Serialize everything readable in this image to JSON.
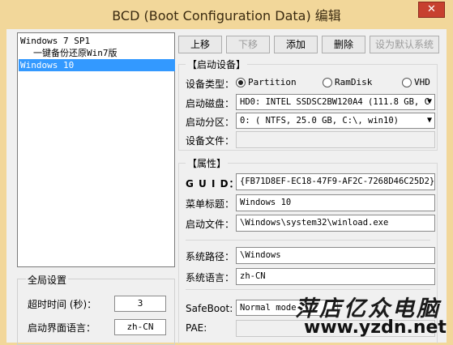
{
  "window": {
    "title": "BCD (Boot Configuration Data) 编辑",
    "close_glyph": "✕"
  },
  "boot_list": {
    "items": [
      {
        "label": "Windows 7 SP1",
        "indent": false,
        "selected": false
      },
      {
        "label": "一键备份还原Win7版",
        "indent": true,
        "selected": false
      },
      {
        "label": "Windows 10",
        "indent": false,
        "selected": true
      }
    ]
  },
  "global_settings": {
    "title": "全局设置",
    "timeout_label": "超时时间 (秒)：",
    "timeout_value": "3",
    "language_label": "启动界面语言：",
    "language_value": "zh-CN"
  },
  "toolbar": {
    "up": "上移",
    "down": "下移",
    "add": "添加",
    "delete": "删除",
    "set_default": "设为默认系统"
  },
  "boot_device": {
    "title": "【启动设备】",
    "device_type_label": "设备类型：",
    "device_types": [
      "Partition",
      "RamDisk",
      "VHD"
    ],
    "selected_type": "Partition",
    "disk_label": "启动磁盘：",
    "disk_value": "HD0: INTEL SSDSC2BW120A4 (111.8 GB, C",
    "partition_label": "启动分区：",
    "partition_value": "0: ( NTFS,  25.0 GB, C:\\, win10)",
    "device_file_label": "设备文件：",
    "device_file_value": ""
  },
  "properties": {
    "title": "【属性】",
    "guid_label": "G U I D：",
    "guid_value": "{FB71D8EF-EC18-47F9-AF2C-7268D46C25D2}",
    "menu_title_label": "菜单标题：",
    "menu_title_value": "Windows 10",
    "boot_file_label": "启动文件：",
    "boot_file_value": "\\Windows\\system32\\winload.exe",
    "system_path_label": "系统路径：",
    "system_path_value": "\\Windows",
    "system_language_label": "系统语言：",
    "system_language_value": "zh-CN",
    "safeboot_label": "SafeBoot:",
    "safeboot_value": "Normal mode",
    "pae_label": "PAE:"
  },
  "watermark": {
    "cn": "萍店亿众电脑",
    "url": "www.yzdn.net"
  }
}
